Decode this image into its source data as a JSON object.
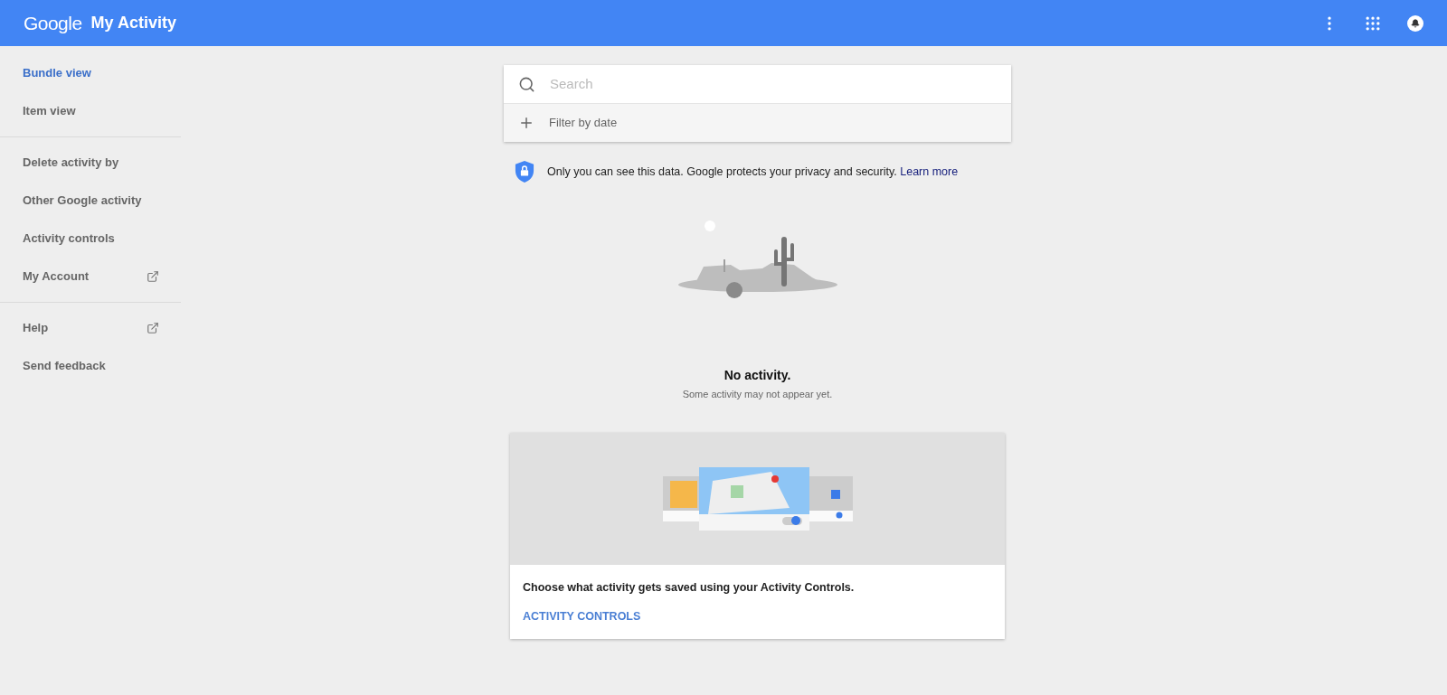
{
  "header": {
    "logo": "Google",
    "title": "My Activity"
  },
  "sidebar": {
    "sections": [
      {
        "items": [
          {
            "label": "Bundle view",
            "selected": true,
            "external": false
          },
          {
            "label": "Item view",
            "selected": false,
            "external": false
          }
        ]
      },
      {
        "items": [
          {
            "label": "Delete activity by",
            "selected": false,
            "external": false
          },
          {
            "label": "Other Google activity",
            "selected": false,
            "external": false
          },
          {
            "label": "Activity controls",
            "selected": false,
            "external": false
          },
          {
            "label": "My Account",
            "selected": false,
            "external": true
          }
        ]
      },
      {
        "items": [
          {
            "label": "Help",
            "selected": false,
            "external": true
          },
          {
            "label": "Send feedback",
            "selected": false,
            "external": false
          }
        ]
      }
    ]
  },
  "search": {
    "placeholder": "Search",
    "filter_label": "Filter by date"
  },
  "privacy_notice": {
    "text": "Only you can see this data. Google protects your privacy and security.",
    "link": "Learn more"
  },
  "empty_state": {
    "title": "No activity.",
    "subtitle": "Some activity may not appear yet."
  },
  "promo_card": {
    "text": "Choose what activity gets saved using your Activity Controls.",
    "action": "ACTIVITY CONTROLS"
  }
}
